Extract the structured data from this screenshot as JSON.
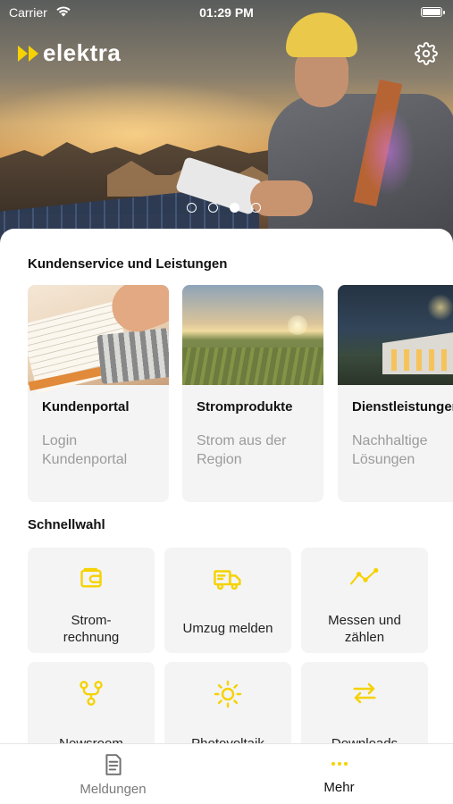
{
  "colors": {
    "accent": "#F5D200",
    "card_bg": "#F4F4F4",
    "muted_text": "#9B9B9B"
  },
  "status_bar": {
    "carrier": "Carrier",
    "time": "01:29 PM"
  },
  "header": {
    "logo_text": "elektra",
    "settings_icon": "gear-icon"
  },
  "carousel": {
    "pages": 4,
    "active_page": 3
  },
  "services": {
    "title": "Kundenservice und Leistungen",
    "cards": [
      {
        "title": "Kundenportal",
        "subtitle": "Login Kundenportal"
      },
      {
        "title": "Stromprodukte",
        "subtitle": "Strom aus der Region"
      },
      {
        "title": "Dienstleistungen",
        "subtitle": "Nachhaltige Lösungen"
      }
    ]
  },
  "quick": {
    "title": "Schnellwahl",
    "tiles": [
      {
        "label": "Strom-\nrechnung",
        "icon": "wallet-icon"
      },
      {
        "label": "Umzug melden",
        "icon": "truck-icon"
      },
      {
        "label": "Messen und zählen",
        "icon": "chart-line-icon"
      },
      {
        "label": "Newsroom",
        "icon": "branch-icon"
      },
      {
        "label": "Photovoltaik",
        "icon": "sun-icon"
      },
      {
        "label": "Downloads",
        "icon": "swap-arrows-icon"
      }
    ]
  },
  "tabbar": {
    "tabs": [
      {
        "label": "Meldungen",
        "icon": "document-icon",
        "active": false
      },
      {
        "label": "Mehr",
        "icon": "more-dots-icon",
        "active": true
      }
    ]
  }
}
